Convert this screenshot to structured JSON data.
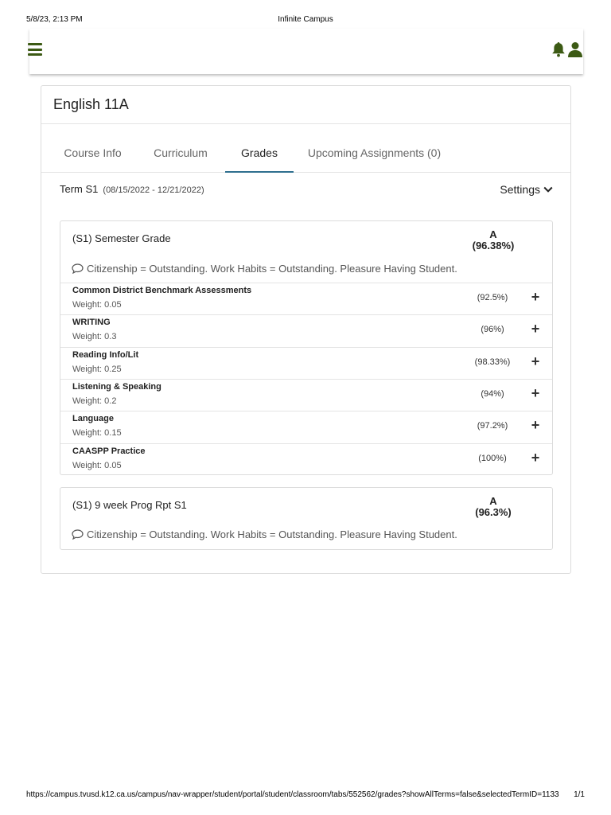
{
  "print": {
    "datetime": "5/8/23, 2:13 PM",
    "page_title": "Infinite Campus",
    "url": "https://campus.tvusd.k12.ca.us/campus/nav-wrapper/student/portal/student/classroom/tabs/552562/grades?showAllTerms=false&selectedTermID=1133",
    "page_number": "1/1"
  },
  "topbar": {
    "menu_icon": "hamburger-menu-icon",
    "notification_icon": "bell-icon",
    "user_icon": "person-icon",
    "accent_color": "#3c5a14"
  },
  "course": {
    "title": "English 11A"
  },
  "tabs": [
    {
      "label": "Course Info",
      "active": false
    },
    {
      "label": "Curriculum",
      "active": false
    },
    {
      "label": "Grades",
      "active": true
    },
    {
      "label": "Upcoming Assignments (0)",
      "active": false
    }
  ],
  "term": {
    "label": "Term S1",
    "dates": "(08/15/2022 - 12/21/2022)",
    "settings_label": "Settings"
  },
  "semester_grade": {
    "title": "(S1) Semester Grade",
    "letter": "A",
    "percent": "(96.38%)",
    "comment": "Citizenship = Outstanding. Work Habits = Outstanding. Pleasure Having Student.",
    "categories": [
      {
        "name": "Common District Benchmark Assessments",
        "weight": "Weight: 0.05",
        "percent": "(92.5%)"
      },
      {
        "name": "WRITING",
        "weight": "Weight: 0.3",
        "percent": "(96%)"
      },
      {
        "name": "Reading Info/Lit",
        "weight": "Weight: 0.25",
        "percent": "(98.33%)"
      },
      {
        "name": "Listening & Speaking",
        "weight": "Weight: 0.2",
        "percent": "(94%)"
      },
      {
        "name": "Language",
        "weight": "Weight: 0.15",
        "percent": "(97.2%)"
      },
      {
        "name": "CAASPP Practice",
        "weight": "Weight: 0.05",
        "percent": "(100%)"
      }
    ]
  },
  "progress_report": {
    "title": "(S1) 9 week Prog Rpt S1",
    "letter": "A",
    "percent": "(96.3%)",
    "comment": "Citizenship = Outstanding. Work Habits = Outstanding. Pleasure Having Student."
  },
  "expand_symbol": "+"
}
